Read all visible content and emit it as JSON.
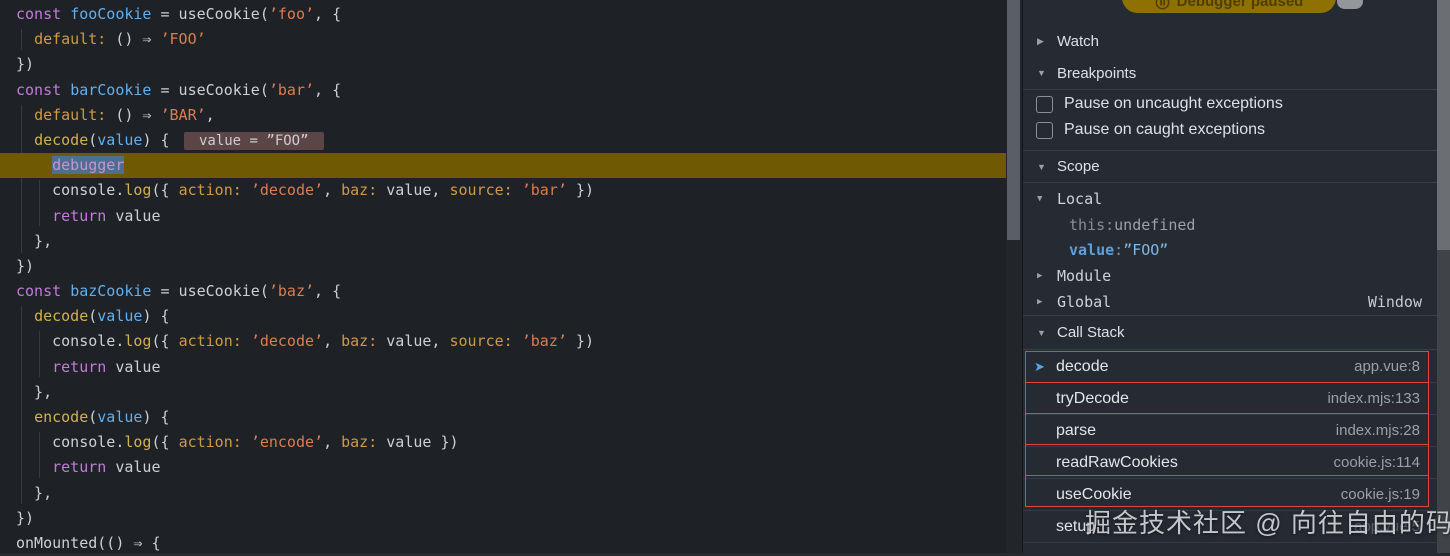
{
  "editor": {
    "paused_line": 6,
    "hint_line": 5,
    "inline_hint": " value = ”FOO” ",
    "lines": [
      [
        [
          "kw",
          "const"
        ],
        [
          "pl",
          " "
        ],
        [
          "vr",
          "fooCookie"
        ],
        [
          "pl",
          " = useCookie("
        ],
        [
          "st",
          "’foo’"
        ],
        [
          "pl",
          ", {"
        ]
      ],
      [
        [
          "pl",
          "  "
        ],
        [
          "pr",
          "default:"
        ],
        [
          "pl",
          " () ⇒ "
        ],
        [
          "st",
          "’FOO’"
        ]
      ],
      [
        [
          "pl",
          "})"
        ]
      ],
      [
        [
          "kw",
          "const"
        ],
        [
          "pl",
          " "
        ],
        [
          "vr",
          "barCookie"
        ],
        [
          "pl",
          " = useCookie("
        ],
        [
          "st",
          "’bar’"
        ],
        [
          "pl",
          ", {"
        ]
      ],
      [
        [
          "pl",
          "  "
        ],
        [
          "pr",
          "default:"
        ],
        [
          "pl",
          " () ⇒ "
        ],
        [
          "st",
          "’BAR’"
        ],
        [
          "pl",
          ","
        ]
      ],
      [
        [
          "pl",
          "  "
        ],
        [
          "fn",
          "decode"
        ],
        [
          "pl",
          "("
        ],
        [
          "vr",
          "value"
        ],
        [
          "pl",
          ") {"
        ]
      ],
      [
        [
          "pl",
          "    "
        ],
        [
          "sel",
          "debugger"
        ]
      ],
      [
        [
          "pl",
          "    console."
        ],
        [
          "fn",
          "log"
        ],
        [
          "pl",
          "({ "
        ],
        [
          "pr",
          "action:"
        ],
        [
          "pl",
          " "
        ],
        [
          "st",
          "’decode’"
        ],
        [
          "pl",
          ", "
        ],
        [
          "pr",
          "baz:"
        ],
        [
          "pl",
          " value, "
        ],
        [
          "pr",
          "source:"
        ],
        [
          "pl",
          " "
        ],
        [
          "st",
          "’bar’"
        ],
        [
          "pl",
          " })"
        ]
      ],
      [
        [
          "pl",
          "    "
        ],
        [
          "kw",
          "return"
        ],
        [
          "pl",
          " value"
        ]
      ],
      [
        [
          "pl",
          "  },"
        ]
      ],
      [
        [
          "pl",
          "})"
        ]
      ],
      [
        [
          "kw",
          "const"
        ],
        [
          "pl",
          " "
        ],
        [
          "vr",
          "bazCookie"
        ],
        [
          "pl",
          " = useCookie("
        ],
        [
          "st",
          "’baz’"
        ],
        [
          "pl",
          ", {"
        ]
      ],
      [
        [
          "pl",
          "  "
        ],
        [
          "fn",
          "decode"
        ],
        [
          "pl",
          "("
        ],
        [
          "vr",
          "value"
        ],
        [
          "pl",
          ") {"
        ]
      ],
      [
        [
          "pl",
          "    console."
        ],
        [
          "fn",
          "log"
        ],
        [
          "pl",
          "({ "
        ],
        [
          "pr",
          "action:"
        ],
        [
          "pl",
          " "
        ],
        [
          "st",
          "’decode’"
        ],
        [
          "pl",
          ", "
        ],
        [
          "pr",
          "baz:"
        ],
        [
          "pl",
          " value, "
        ],
        [
          "pr",
          "source:"
        ],
        [
          "pl",
          " "
        ],
        [
          "st",
          "’baz’"
        ],
        [
          "pl",
          " })"
        ]
      ],
      [
        [
          "pl",
          "    "
        ],
        [
          "kw",
          "return"
        ],
        [
          "pl",
          " value"
        ]
      ],
      [
        [
          "pl",
          "  },"
        ]
      ],
      [
        [
          "pl",
          "  "
        ],
        [
          "fn",
          "encode"
        ],
        [
          "pl",
          "("
        ],
        [
          "vr",
          "value"
        ],
        [
          "pl",
          ") {"
        ]
      ],
      [
        [
          "pl",
          "    console."
        ],
        [
          "fn",
          "log"
        ],
        [
          "pl",
          "({ "
        ],
        [
          "pr",
          "action:"
        ],
        [
          "pl",
          " "
        ],
        [
          "st",
          "’encode’"
        ],
        [
          "pl",
          ", "
        ],
        [
          "pr",
          "baz:"
        ],
        [
          "pl",
          " value })"
        ]
      ],
      [
        [
          "pl",
          "    "
        ],
        [
          "kw",
          "return"
        ],
        [
          "pl",
          " value"
        ]
      ],
      [
        [
          "pl",
          "  },"
        ]
      ],
      [
        [
          "pl",
          "})"
        ]
      ],
      [
        [
          "pl",
          "onMounted(() ⇒ {"
        ]
      ]
    ]
  },
  "sidebar": {
    "pill_label": "Debugger paused",
    "sections": {
      "watch": "Watch",
      "breakpoints": "Breakpoints",
      "scope": "Scope",
      "call_stack": "Call Stack"
    },
    "breakpoint_options": [
      {
        "label": "Pause on uncaught exceptions",
        "checked": false
      },
      {
        "label": "Pause on caught exceptions",
        "checked": false
      }
    ],
    "scope": {
      "groups": [
        {
          "label": "Local",
          "expanded": true
        },
        {
          "label": "Module",
          "expanded": false
        },
        {
          "label": "Global",
          "expanded": false,
          "value": "Window"
        }
      ],
      "local_entries": [
        {
          "key": "this",
          "value": "undefined",
          "key_style": "k-dim",
          "value_style": "v-dim"
        },
        {
          "key": "value",
          "value": "”FOO”",
          "key_style": "k-blue",
          "value_style": "v-lightblue"
        }
      ]
    },
    "call_stack": {
      "frames": [
        {
          "name": "decode",
          "location": "app.vue:8",
          "current": true
        },
        {
          "name": "tryDecode",
          "location": "index.mjs:133"
        },
        {
          "name": "parse",
          "location": "index.mjs:28"
        },
        {
          "name": "readRawCookies",
          "location": "cookie.js:114"
        },
        {
          "name": "useCookie",
          "location": "cookie.js:19"
        },
        {
          "name": "setup",
          "location": "app.vue:5",
          "dim": true
        }
      ]
    }
  },
  "watermark": "掘金技术社区 @ 向往自由的码",
  "colors": {
    "editor_bg": "#1e2227",
    "sidebar_bg": "#262b33",
    "paused_line": "#6f5902",
    "pill_bg": "#8f7102",
    "annotation_red": "#e0463c",
    "current_frame_arrow": "#53a7e8",
    "keyword": "#c678dd",
    "variable": "#61afef",
    "function": "#d2b14c",
    "property": "#cf9a43",
    "string": "#dd7c4e"
  }
}
